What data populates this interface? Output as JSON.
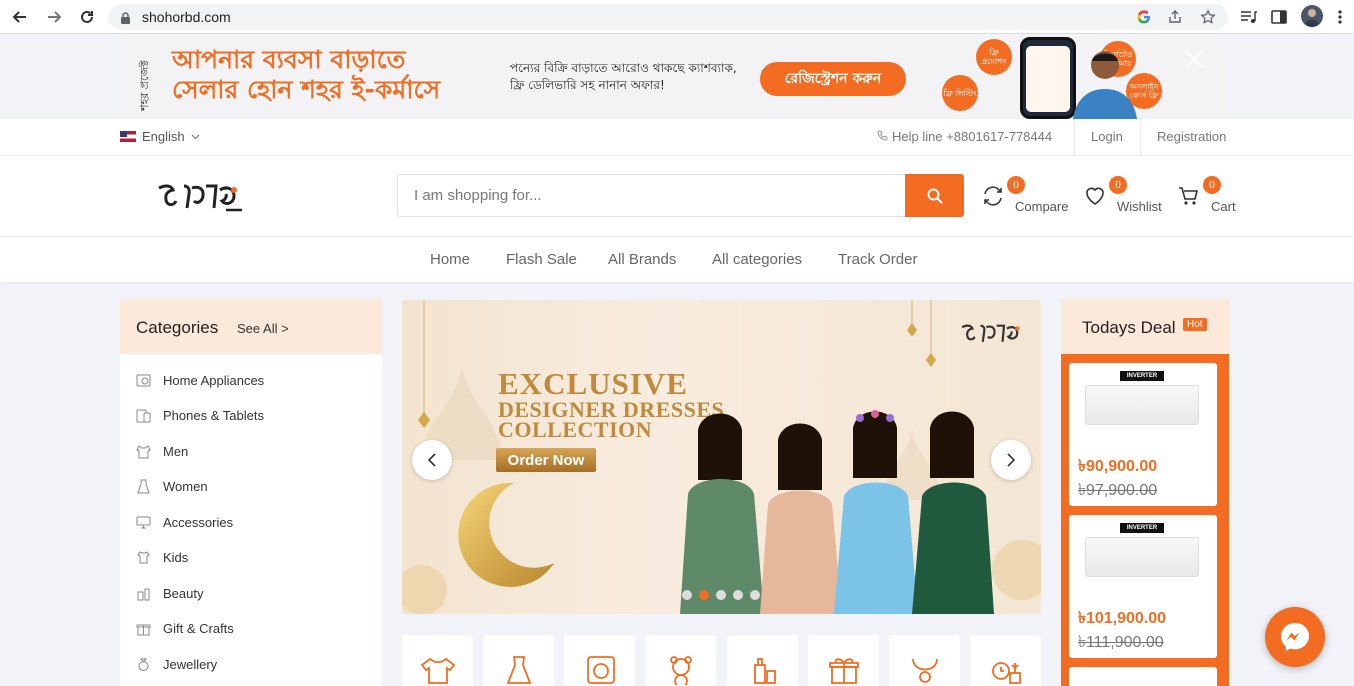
{
  "browser": {
    "url": "shohorbd.com"
  },
  "promo": {
    "vertical_text": "শহর প্রজেক্ট",
    "headline_1": "আপনার ব্যবসা বাড়াতে",
    "headline_2": "সেলার হোন শহর ই-কর্মাসে",
    "sub_1": "পন্যের বিক্রি বাড়াতে আরোও থাকছে ক্যাশব্যাক,",
    "sub_2": "ফ্রি ডেলিভারি সহ নানান অফার!",
    "cta": "রেজিস্ট্রেশন করুন",
    "bubbles": [
      "ফ্রি প্রমোশন",
      "ফ্রি লিস্টিং",
      "টার্গেটেড কাস্টমার",
      "অনলাইন কোর্স ফ্রি"
    ]
  },
  "topbar": {
    "language": "English",
    "helpline": "Help line +8801617-778444",
    "login": "Login",
    "registration": "Registration"
  },
  "header": {
    "search_placeholder": "I am shopping for...",
    "compare_label": "Compare",
    "compare_count": "0",
    "wishlist_label": "Wishlist",
    "wishlist_count": "0",
    "cart_label": "Cart",
    "cart_count": "0"
  },
  "nav": {
    "items": [
      "Home",
      "Flash Sale",
      "All Brands",
      "All categories",
      "Track Order"
    ]
  },
  "categories": {
    "title": "Categories",
    "see_all": "See All >",
    "items": [
      {
        "label": "Home Appliances",
        "icon": "appliance-icon"
      },
      {
        "label": "Phones & Tablets",
        "icon": "phone-icon"
      },
      {
        "label": "Men",
        "icon": "men-icon"
      },
      {
        "label": "Women",
        "icon": "women-icon"
      },
      {
        "label": "Accessories",
        "icon": "accessories-icon"
      },
      {
        "label": "Kids",
        "icon": "kids-icon"
      },
      {
        "label": "Beauty",
        "icon": "beauty-icon"
      },
      {
        "label": "Gift & Crafts",
        "icon": "gift-icon"
      },
      {
        "label": "Jewellery",
        "icon": "jewellery-icon"
      }
    ]
  },
  "slider": {
    "title_1": "EXCLUSIVE",
    "title_2": "DESIGNER DRESSES",
    "title_3": "COLLECTION",
    "cta": "Order Now",
    "slide_count": 5,
    "active_slide": 2
  },
  "deal": {
    "title": "Todays Deal",
    "badge": "Hot",
    "products": [
      {
        "tag": "INVERTER",
        "price": "৳90,900.00",
        "old_price": "৳97,900.00"
      },
      {
        "tag": "INVERTER",
        "price": "৳101,900.00",
        "old_price": "৳111,900.00"
      }
    ]
  },
  "colors": {
    "accent": "#f36c21",
    "header_tint": "#fce9d9",
    "page_bg": "#f2f3f8"
  }
}
